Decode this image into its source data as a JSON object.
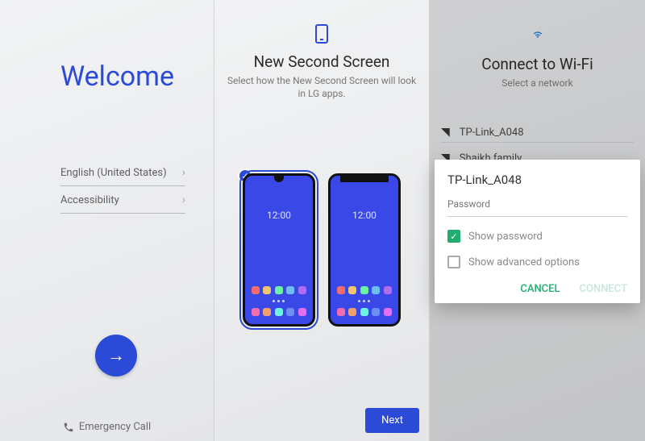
{
  "panel1": {
    "title": "Welcome",
    "language": "English (United States)",
    "accessibility": "Accessibility",
    "emergency": "Emergency Call"
  },
  "panel2": {
    "title": "New Second Screen",
    "subtitle": "Select how the New Second Screen will look in LG apps.",
    "clock": "12:00",
    "next": "Next",
    "app_colors": [
      "#f26d6d",
      "#f2c46d",
      "#6df2a1",
      "#6dbef2",
      "#b06df2",
      "#f26db0",
      "#f2a16d",
      "#6df2e4",
      "#6d8ef2",
      "#e46df2"
    ]
  },
  "panel3": {
    "title": "Connect to Wi-Fi",
    "subtitle": "Select a network",
    "networks": [
      {
        "ssid": "TP-Link_A048"
      },
      {
        "ssid": "Shaikh family"
      }
    ],
    "dialog": {
      "ssid": "TP-Link_A048",
      "password_placeholder": "Password",
      "show_password": "Show password",
      "show_advanced": "Show advanced options",
      "cancel": "CANCEL",
      "connect": "CONNECT"
    }
  }
}
